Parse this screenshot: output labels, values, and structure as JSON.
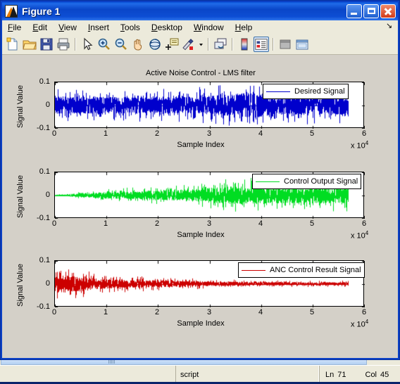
{
  "window": {
    "title": "Figure 1",
    "app_icon": "matlab-membrane-icon",
    "buttons": {
      "minimize": "minimize-button",
      "maximize": "maximize-button",
      "close": "close-button"
    }
  },
  "menubar": {
    "items": [
      {
        "label": "File",
        "mnemonic": "F"
      },
      {
        "label": "Edit",
        "mnemonic": "E"
      },
      {
        "label": "View",
        "mnemonic": "V"
      },
      {
        "label": "Insert",
        "mnemonic": "I"
      },
      {
        "label": "Tools",
        "mnemonic": "T"
      },
      {
        "label": "Desktop",
        "mnemonic": "D"
      },
      {
        "label": "Window",
        "mnemonic": "W"
      },
      {
        "label": "Help",
        "mnemonic": "H"
      }
    ],
    "dock_control": "dock-arrow-icon"
  },
  "toolbar": {
    "items": [
      {
        "name": "new-figure-icon",
        "tooltip": "New Figure"
      },
      {
        "name": "open-file-icon",
        "tooltip": "Open File"
      },
      {
        "name": "save-figure-icon",
        "tooltip": "Save Figure"
      },
      {
        "name": "print-figure-icon",
        "tooltip": "Print Figure"
      },
      {
        "name": "edit-plot-pointer-icon",
        "tooltip": "Edit Plot"
      },
      {
        "name": "zoom-in-icon",
        "tooltip": "Zoom In"
      },
      {
        "name": "zoom-out-icon",
        "tooltip": "Zoom Out"
      },
      {
        "name": "pan-hand-icon",
        "tooltip": "Pan"
      },
      {
        "name": "rotate-3d-icon",
        "tooltip": "Rotate 3D"
      },
      {
        "name": "data-cursor-icon",
        "tooltip": "Data Cursor"
      },
      {
        "name": "brush-data-icon",
        "tooltip": "Brush/Select Data"
      },
      {
        "name": "brush-dropdown-icon",
        "tooltip": "Brush Options"
      },
      {
        "name": "link-plot-icon",
        "tooltip": "Link Plot"
      },
      {
        "name": "colorbar-icon",
        "tooltip": "Insert Colorbar"
      },
      {
        "name": "legend-icon",
        "tooltip": "Insert Legend",
        "state": "pressed"
      },
      {
        "name": "hide-plot-tools-icon",
        "tooltip": "Hide Plot Tools"
      },
      {
        "name": "show-plot-tools-icon",
        "tooltip": "Show Plot Tools and Dock Figure"
      }
    ]
  },
  "statusbar": {
    "mode": "script",
    "line_label": "Ln",
    "line_value": "71",
    "col_label": "Col",
    "col_value": "45"
  },
  "chart_data": [
    {
      "type": "line",
      "title": "Active Noise Control - LMS filter",
      "xlabel": "Sample Index",
      "ylabel": "Signal Value",
      "x_exponent_label": "x 10",
      "x_exponent_power": "4",
      "xlim": [
        0,
        6
      ],
      "ylim": [
        -0.1,
        0.1
      ],
      "xticks": [
        "0",
        "1",
        "2",
        "3",
        "4",
        "5",
        "6"
      ],
      "yticks": [
        "0.1",
        "0",
        "-0.1"
      ],
      "grid": false,
      "legend_position": "north-east",
      "series": [
        {
          "name": "Desired Signal",
          "color": "#0000cc",
          "x_end": 5.68,
          "envelope_x": [
            0.0,
            0.3,
            0.6,
            0.9,
            1.2,
            1.5,
            1.8,
            2.1,
            2.4,
            2.7,
            3.0,
            3.3,
            3.6,
            3.9,
            4.1,
            4.4,
            4.7,
            5.0,
            5.3,
            5.68
          ],
          "envelope_amplitude": [
            0.052,
            0.05,
            0.049,
            0.048,
            0.048,
            0.047,
            0.046,
            0.046,
            0.047,
            0.05,
            0.055,
            0.062,
            0.069,
            0.076,
            0.062,
            0.058,
            0.056,
            0.055,
            0.055,
            0.055
          ]
        }
      ]
    },
    {
      "type": "line",
      "title": "",
      "xlabel": "Sample Index",
      "ylabel": "Signal Value",
      "x_exponent_label": "x 10",
      "x_exponent_power": "4",
      "xlim": [
        0,
        6
      ],
      "ylim": [
        -0.1,
        0.1
      ],
      "xticks": [
        "0",
        "1",
        "2",
        "3",
        "4",
        "5",
        "6"
      ],
      "yticks": [
        "0.1",
        "0",
        "-0.1"
      ],
      "grid": false,
      "legend_position": "north-east",
      "series": [
        {
          "name": "Control Output Signal",
          "color": "#00dd22",
          "x_end": 5.68,
          "envelope_x": [
            0.0,
            0.2,
            0.4,
            0.7,
            1.0,
            1.3,
            1.6,
            1.9,
            2.2,
            2.5,
            2.8,
            3.1,
            3.4,
            3.7,
            4.0,
            4.3,
            4.6,
            4.9,
            5.2,
            5.68
          ],
          "envelope_amplitude": [
            0.002,
            0.005,
            0.009,
            0.014,
            0.019,
            0.022,
            0.024,
            0.026,
            0.029,
            0.033,
            0.038,
            0.045,
            0.052,
            0.05,
            0.049,
            0.048,
            0.048,
            0.048,
            0.049,
            0.049
          ]
        }
      ]
    },
    {
      "type": "line",
      "title": "",
      "xlabel": "Sample Index",
      "ylabel": "Signal Value",
      "x_exponent_label": "x 10",
      "x_exponent_power": "4",
      "xlim": [
        0,
        6
      ],
      "ylim": [
        -0.1,
        0.1
      ],
      "xticks": [
        "0",
        "1",
        "2",
        "3",
        "4",
        "5",
        "6"
      ],
      "yticks": [
        "0.1",
        "0",
        "-0.1"
      ],
      "grid": false,
      "legend_position": "north-east",
      "series": [
        {
          "name": "ANC Control Result Signal",
          "color": "#cc0000",
          "x_end": 5.68,
          "envelope_x": [
            0.0,
            0.15,
            0.3,
            0.5,
            0.75,
            1.0,
            1.3,
            1.6,
            1.9,
            2.2,
            2.5,
            2.8,
            3.1,
            3.4,
            3.7,
            4.0,
            4.4,
            4.8,
            5.2,
            5.68
          ],
          "envelope_amplitude": [
            0.048,
            0.052,
            0.046,
            0.04,
            0.034,
            0.029,
            0.025,
            0.022,
            0.02,
            0.018,
            0.016,
            0.015,
            0.013,
            0.012,
            0.011,
            0.01,
            0.01,
            0.009,
            0.009,
            0.009
          ]
        }
      ]
    }
  ]
}
